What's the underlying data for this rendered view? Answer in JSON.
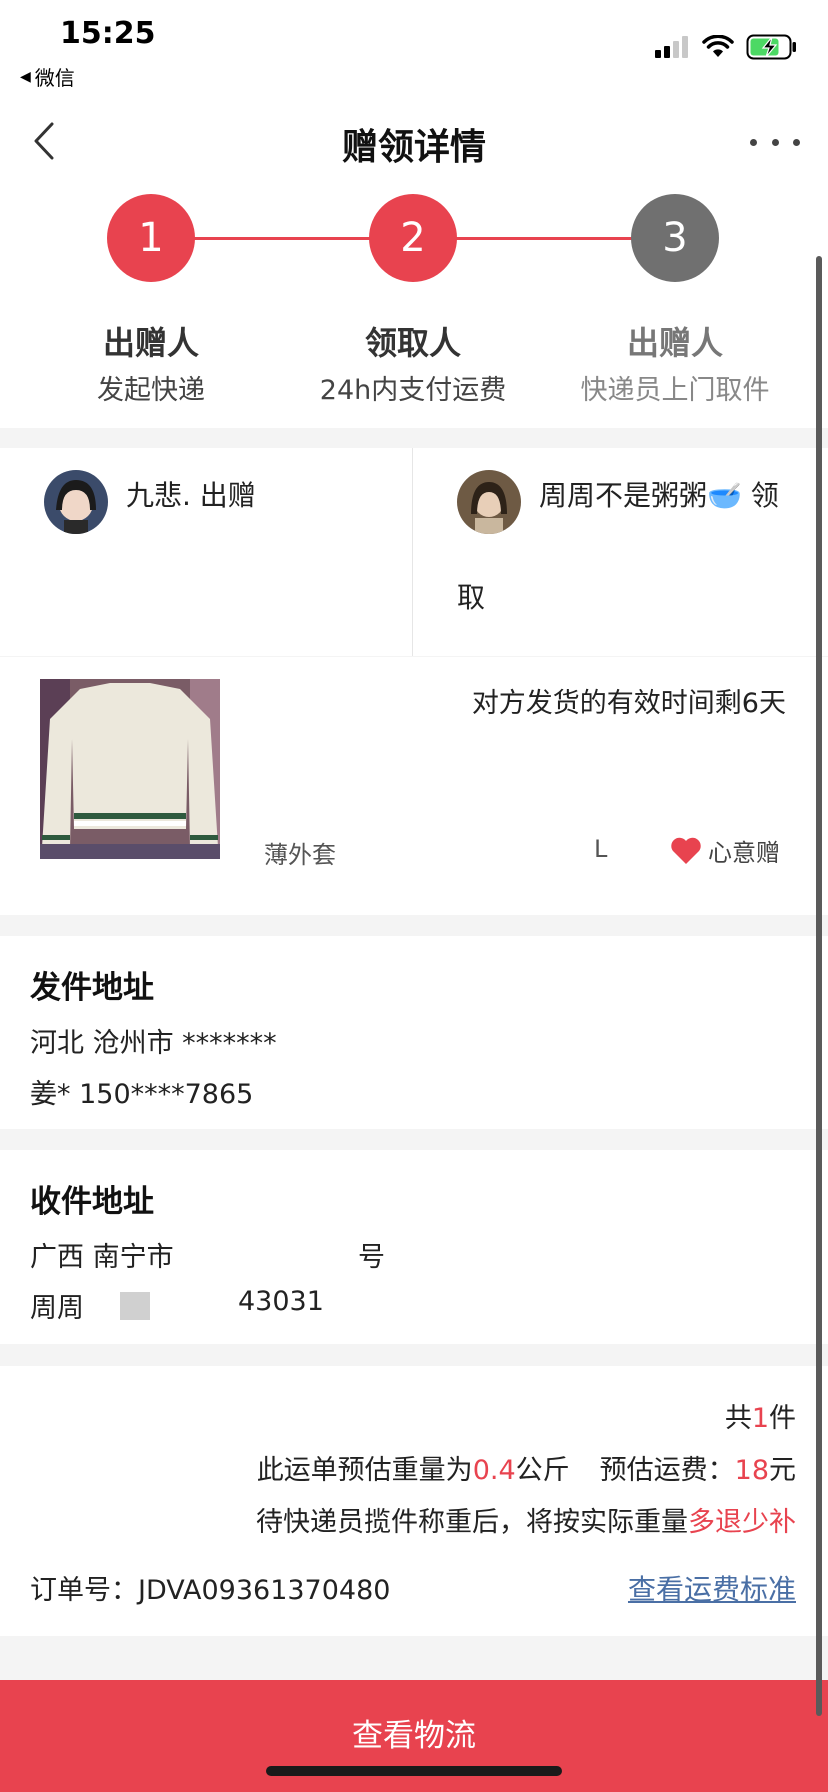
{
  "status_bar": {
    "time": "15:25",
    "back_label": "微信"
  },
  "nav": {
    "title": "赠领详情"
  },
  "steps": [
    {
      "num": "1",
      "title": "出赠人",
      "sub": "发起快递",
      "color": "#e8434f"
    },
    {
      "num": "2",
      "title": "领取人",
      "sub": "24h内支付运费",
      "color": "#e8434f"
    },
    {
      "num": "3",
      "title": "出赠人",
      "sub": "快递员上门取件",
      "color": "#707070"
    }
  ],
  "users": {
    "giver": "九悲. 出赠",
    "receiver_line1": "周周不是粥粥🥣 领",
    "receiver_line2": "取"
  },
  "item": {
    "remaining_text": "对方发货的有效时间剩6天",
    "name": "薄外套",
    "size": "L",
    "tag": "心意赠"
  },
  "sender": {
    "title": "发件地址",
    "line1": "河北 沧州市 *******",
    "line2": "姜* 150****7865"
  },
  "recipient": {
    "title": "收件地址",
    "line1": "广西 南宁市",
    "line1_end": "号",
    "line2": "周周",
    "line2_end": "43031"
  },
  "shipping": {
    "count_prefix": "共",
    "count": "1",
    "count_suffix": "件",
    "weight_prefix": "此运单预估重量为",
    "weight": "0.4",
    "weight_suffix": "公斤",
    "fee_prefix": "预估运费：",
    "fee": "18",
    "fee_suffix": "元",
    "note_prefix": "待快递员揽件称重后，将按实际重量",
    "note_highlight": "多退少补",
    "order_label": "订单号：",
    "order_no": "JDVA09361370480",
    "fee_link": "查看运费标准"
  },
  "bottom_button": "查看物流",
  "colors": {
    "accent": "#e8434f",
    "step_inactive": "#707070",
    "link": "#4a6fa5"
  }
}
